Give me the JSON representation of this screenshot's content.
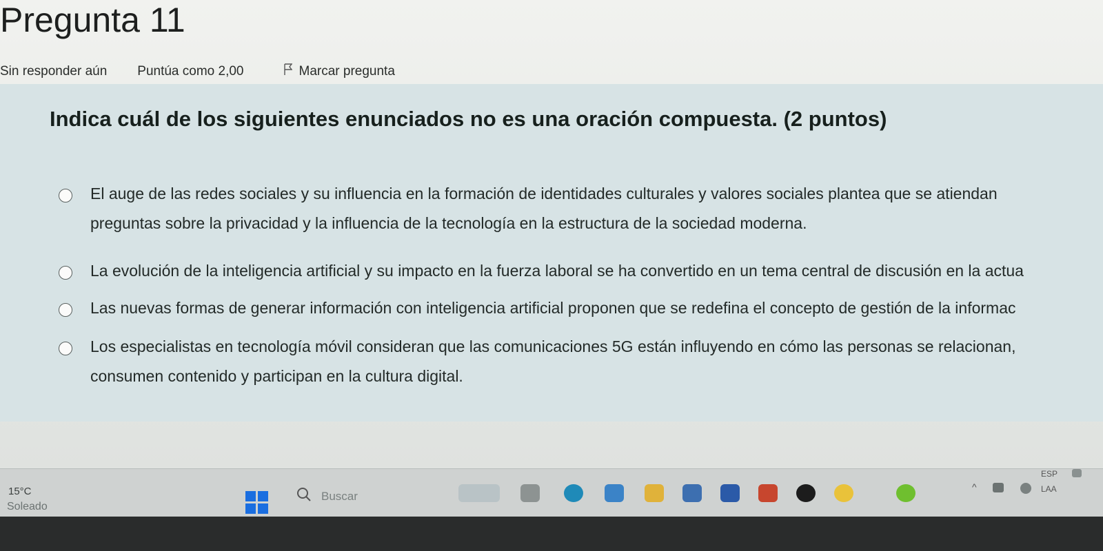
{
  "question": {
    "title": "Pregunta 11",
    "status": "Sin responder aún",
    "score": "Puntúa como 2,00",
    "flag_label": "Marcar pregunta",
    "text": "Indica cuál de los siguientes enunciados no es una oración compuesta. (2 puntos)",
    "options": [
      "El auge de las redes sociales y su influencia en la formación de identidades culturales y valores sociales plantea que se atiendan preguntas sobre la privacidad y la influencia de la tecnología en la estructura de la sociedad moderna.",
      "La evolución de la inteligencia artificial y su impacto en la fuerza laboral se ha convertido en un tema central de discusión en la actua",
      "Las nuevas formas de generar información con inteligencia artificial proponen que se redefina el concepto de gestión de la informac",
      "Los especialistas en tecnología móvil consideran que las comunicaciones 5G están influyendo en cómo las personas se relacionan, consumen contenido y participan en la cultura digital."
    ]
  },
  "taskbar": {
    "temperature": "15°C",
    "weather": "Soleado",
    "search_placeholder": "Buscar",
    "tray_language": "ESP",
    "tray_layout": "LAA",
    "app_icons": [
      "widgets-icon",
      "file-explorer-icon",
      "edge-browser-icon",
      "app-icon",
      "folder-icon",
      "store-icon",
      "word-icon",
      "app-icon",
      "media-icon",
      "chrome-icon",
      "app-icon",
      "notification-icon"
    ]
  },
  "colors": {
    "question_panel": "#d7e3e5",
    "windows_blue": "#1a6ee0",
    "taskbar": "#cfd2d1"
  }
}
